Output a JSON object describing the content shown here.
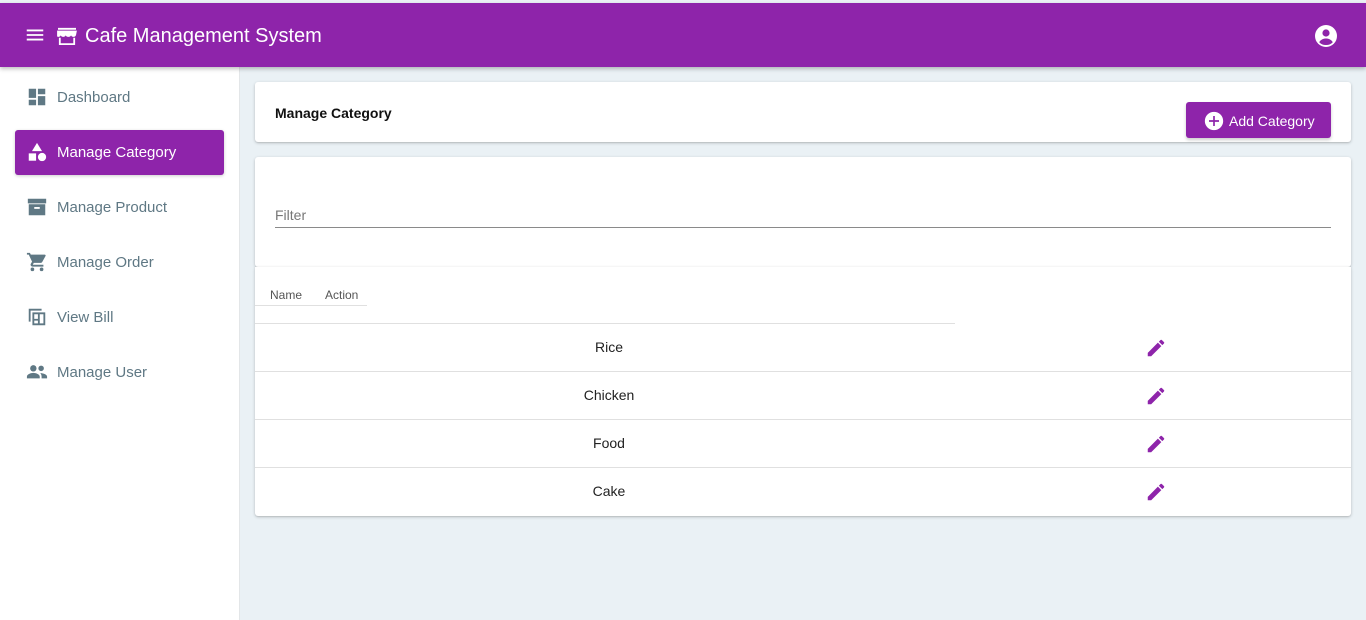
{
  "app": {
    "title": "Cafe Management System",
    "accent": "#8e24aa"
  },
  "sidebar": {
    "items": [
      {
        "label": "Dashboard",
        "icon": "dashboard-icon",
        "active": false
      },
      {
        "label": "Manage Category",
        "icon": "category-icon",
        "active": true
      },
      {
        "label": "Manage Product",
        "icon": "inventory-icon",
        "active": false
      },
      {
        "label": "Manage Order",
        "icon": "shopping-cart-icon",
        "active": false
      },
      {
        "label": "View Bill",
        "icon": "bill-icon",
        "active": false
      },
      {
        "label": "Manage User",
        "icon": "people-icon",
        "active": false
      }
    ]
  },
  "header": {
    "title": "Manage Category",
    "add_button": "Add Category"
  },
  "filter": {
    "placeholder": "Filter",
    "value": ""
  },
  "table": {
    "columns": [
      "Name",
      "Action"
    ],
    "rows": [
      {
        "name": "Rice"
      },
      {
        "name": "Chicken"
      },
      {
        "name": "Food"
      },
      {
        "name": "Cake"
      }
    ]
  }
}
